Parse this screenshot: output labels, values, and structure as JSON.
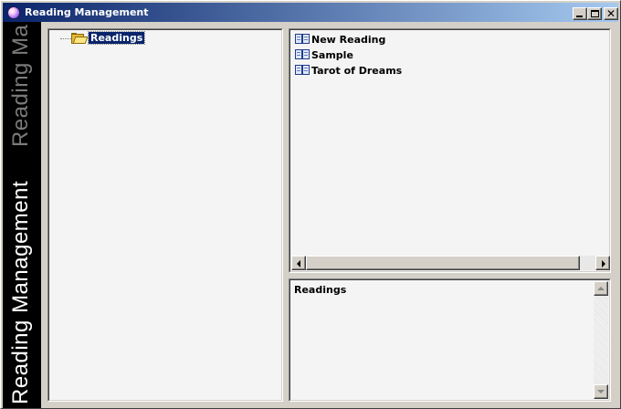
{
  "window": {
    "title": "Reading Management",
    "controls": {
      "minimize": "minimize",
      "maximize": "maximize",
      "close": "✕"
    }
  },
  "sidebar": {
    "banner_text": "Reading Management",
    "banner_ghost_text": "Reading Ma"
  },
  "tree": {
    "root": {
      "label": "Readings",
      "icon": "folder-open-icon",
      "selected": true
    }
  },
  "list": {
    "items": [
      {
        "label": "New Reading",
        "icon": "book-icon"
      },
      {
        "label": "Sample",
        "icon": "book-icon"
      },
      {
        "label": "Tarot of Dreams",
        "icon": "book-icon"
      }
    ]
  },
  "detail": {
    "text": "Readings"
  },
  "colors": {
    "titlebar_start": "#0a246a",
    "titlebar_end": "#a6caf0",
    "chrome": "#d4d0c8",
    "panel": "#f4f4f4",
    "sidebar": "#000000",
    "selection": "#0a246a"
  }
}
